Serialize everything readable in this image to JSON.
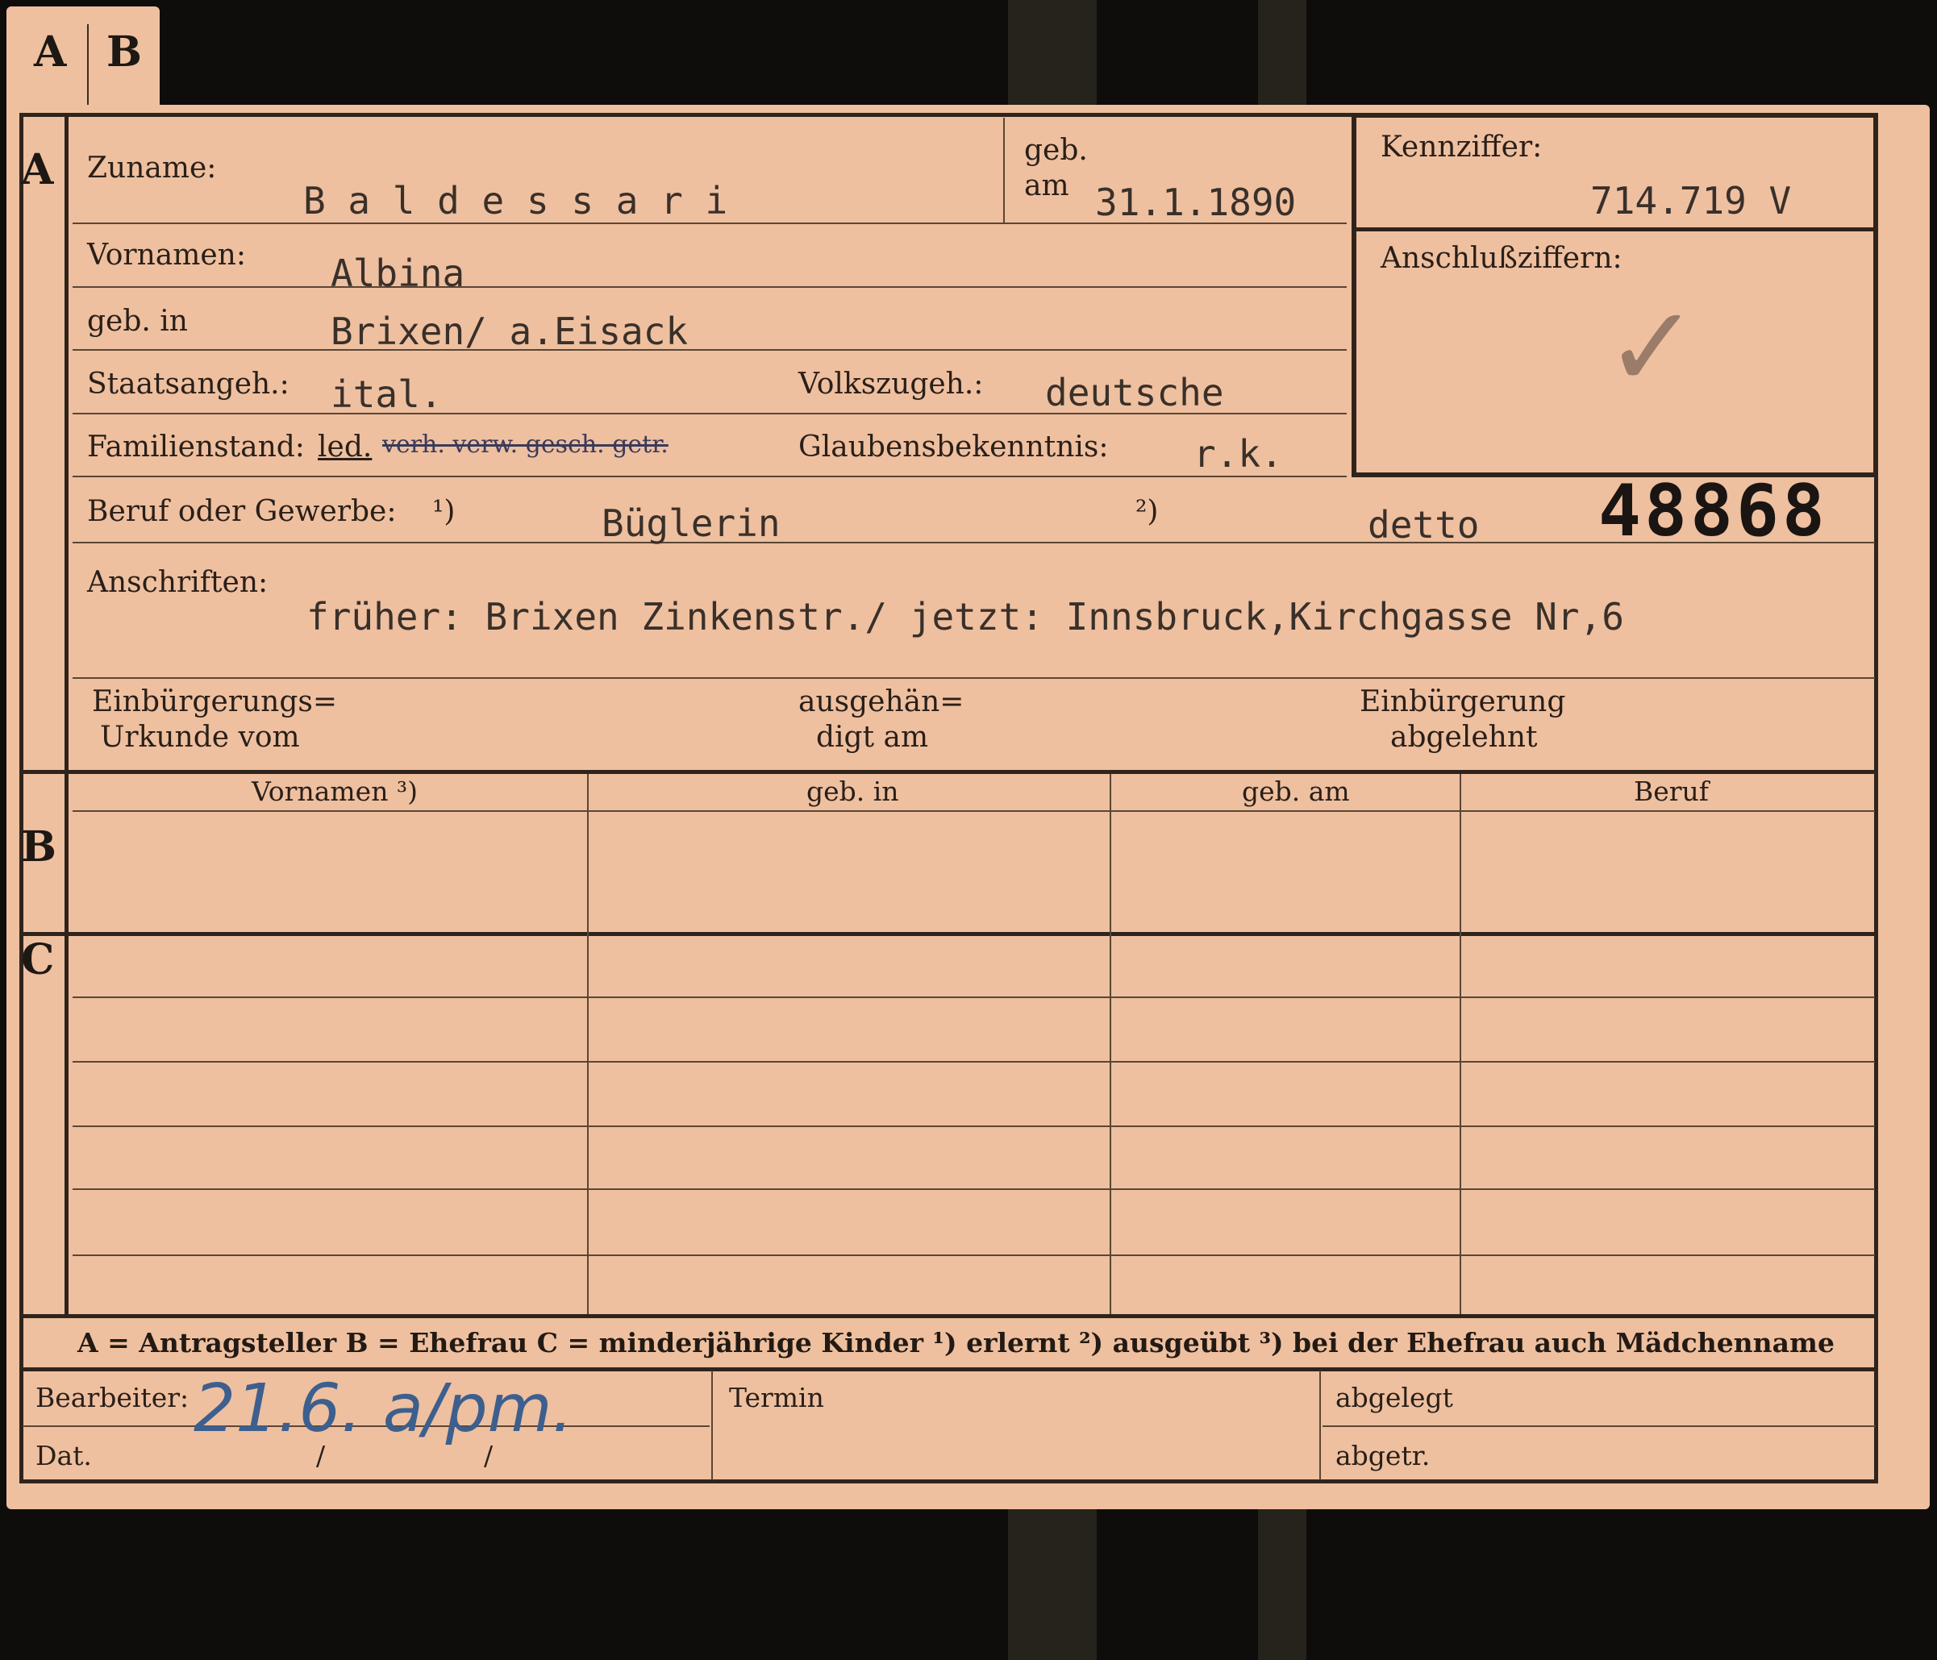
{
  "tab": {
    "a": "A",
    "b": "B"
  },
  "sections": {
    "a": "A",
    "b": "B",
    "c": "C"
  },
  "labels": {
    "zuname": "Zuname:",
    "geb_am_top": "geb.",
    "geb_am_bottom": "am",
    "kennziffer": "Kennziffer:",
    "anschlussziffern": "Anschlußziffern:",
    "vornamen": "Vornamen:",
    "geb_in": "geb. in",
    "staatsangeh": "Staatsangeh.:",
    "volkszugeh": "Volkszugeh.:",
    "familienstand": "Familienstand:",
    "glaubensbekenntnis": "Glaubensbekenntnis:",
    "beruf": "Beruf oder Gewerbe:",
    "fn1": "¹)",
    "fn2": "²)",
    "anschriften": "Anschriften:",
    "einb_urkunde_1": "Einbürgerungs=",
    "einb_urkunde_2": "Urkunde vom",
    "ausgehaendigt_1": "ausgehän=",
    "ausgehaendigt_2": "digt am",
    "einb_abgelehnt_1": "Einbürgerung",
    "einb_abgelehnt_2": "abgelehnt"
  },
  "values": {
    "zuname": "B a l d e s s a r i",
    "geb_am": "31.1.1890",
    "kennziffer": "714.719  V",
    "vornamen": "Albina",
    "geb_in": "Brixen/ a.Eisack",
    "staatsangeh": "ital.",
    "volkszugeh": "deutsche",
    "familienstand_selected": "led.",
    "familienstand_struck": "verh. verw. gesch. getr.",
    "glaube": "r.k.",
    "beruf_erlernt": "Büglerin",
    "beruf_ausgeuebt": "detto",
    "number": "48868",
    "anschrift": "früher: Brixen Zinkenstr./ jetzt: Innsbruck,Kirchgasse Nr,6",
    "checkmark": "✓"
  },
  "table_headers": [
    "Vornamen ³)",
    "geb. in",
    "geb. am",
    "Beruf"
  ],
  "legend": "A = Antragsteller   B = Ehefrau   C = minderjährige Kinder   ¹) erlernt   ²) ausgeübt   ³) bei der Ehefrau auch Mädchenname",
  "footer": {
    "bearbeiter": "Bearbeiter:",
    "dat": "Dat.",
    "termin": "Termin",
    "abgelegt": "abgelegt",
    "abgetr": "abgetr.",
    "handwritten": "21.6. a/pm.",
    "slash1": "/",
    "slash2": "/"
  }
}
